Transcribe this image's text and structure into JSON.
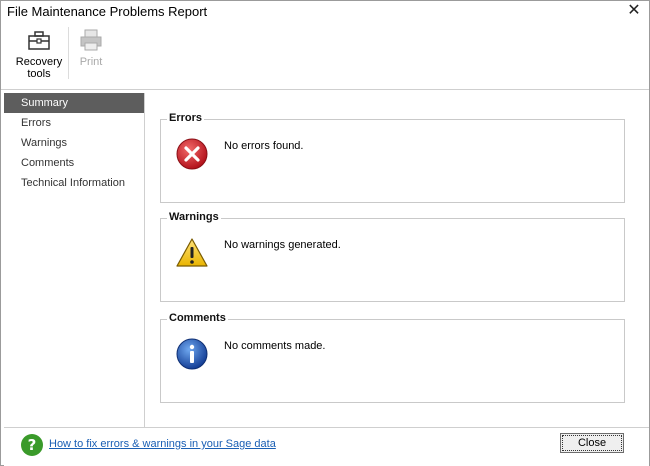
{
  "window": {
    "title": "File Maintenance Problems Report"
  },
  "toolbar": {
    "recovery_label_line1": "Recovery",
    "recovery_label_line2": "tools",
    "print_label": "Print"
  },
  "nav": {
    "items": [
      {
        "label": "Summary",
        "active": true
      },
      {
        "label": "Errors"
      },
      {
        "label": "Warnings"
      },
      {
        "label": "Comments"
      },
      {
        "label": "Technical Information"
      }
    ]
  },
  "sections": {
    "errors": {
      "title": "Errors",
      "message": "No errors found.",
      "icon": "error-icon"
    },
    "warnings": {
      "title": "Warnings",
      "message": "No warnings generated.",
      "icon": "warning-icon"
    },
    "comments": {
      "title": "Comments",
      "message": "No comments made.",
      "icon": "info-icon"
    }
  },
  "footer": {
    "help_link": "How to fix errors & warnings in your Sage data",
    "close_label": "Close"
  },
  "colors": {
    "nav_active_bg": "#5d5d5d",
    "link": "#1a5fb4",
    "error": "#c8202a",
    "warning": "#f2c318",
    "info": "#1f5fbf",
    "help": "#3a9a2a"
  }
}
